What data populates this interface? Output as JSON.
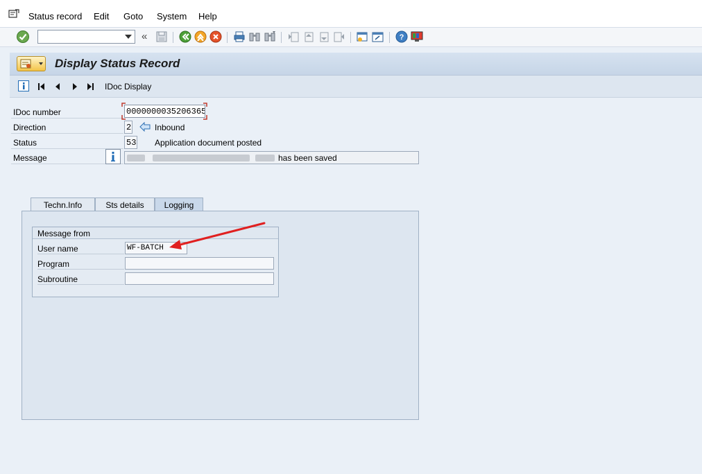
{
  "menu": {
    "items": [
      {
        "label": "Status record"
      },
      {
        "label": "Edit"
      },
      {
        "label": "Goto"
      },
      {
        "label": "System"
      },
      {
        "label": "Help"
      }
    ]
  },
  "toolbar": {
    "command_field_value": "",
    "back_glyph": "«",
    "icons": [
      "save-icon",
      "back-icon",
      "exit-icon",
      "cancel-icon",
      "print-icon",
      "find-icon",
      "find-next-icon",
      "first-page-icon",
      "previous-page-icon",
      "next-page-icon",
      "last-page-icon",
      "create-session-icon",
      "shortcut-icon",
      "help-icon",
      "layout-icon"
    ]
  },
  "title": {
    "text": "Display Status Record"
  },
  "app_toolbar": {
    "idoc_display_label": "IDoc Display"
  },
  "fields": {
    "idoc_number": {
      "label": "IDoc number",
      "value": "0000000035206365"
    },
    "direction": {
      "label": "Direction",
      "value": "2",
      "text": "Inbound"
    },
    "status": {
      "label": "Status",
      "value": "53",
      "text": "Application document posted"
    },
    "message": {
      "label": "Message",
      "suffix": "has been saved"
    }
  },
  "tabs": [
    {
      "label": "Techn.Info",
      "active": false
    },
    {
      "label": "Sts details",
      "active": false
    },
    {
      "label": "Logging",
      "active": true
    }
  ],
  "logging": {
    "group_title": "Message from",
    "user_name": {
      "label": "User name",
      "value": "WF-BATCH"
    },
    "program": {
      "label": "Program",
      "value": ""
    },
    "subroutine": {
      "label": "Subroutine",
      "value": ""
    }
  },
  "colors": {
    "accent_arrow": "#e02020",
    "info_blue": "#1f6bb5"
  }
}
